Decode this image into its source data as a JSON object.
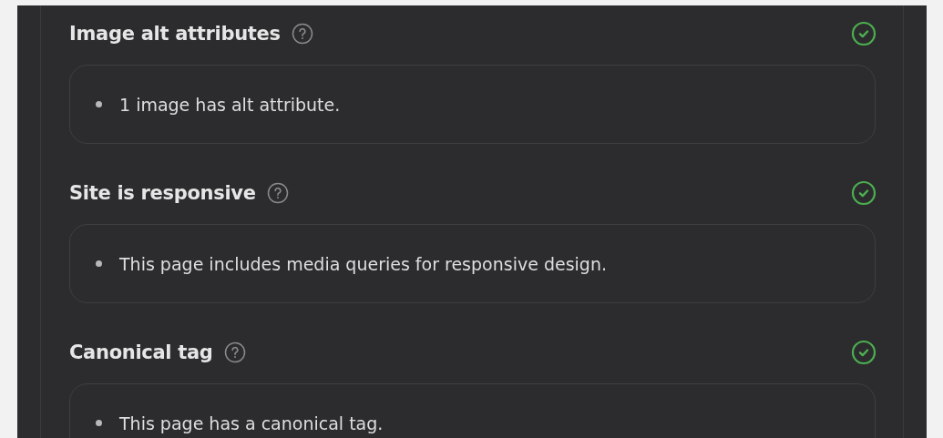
{
  "checks": [
    {
      "title": "Image alt attributes",
      "passed": true,
      "items": [
        "1 image has alt attribute."
      ]
    },
    {
      "title": "Site is responsive",
      "passed": true,
      "items": [
        "This page includes media queries for responsive design."
      ]
    },
    {
      "title": "Canonical tag",
      "passed": true,
      "items": [
        "This page has a canonical tag."
      ]
    }
  ]
}
